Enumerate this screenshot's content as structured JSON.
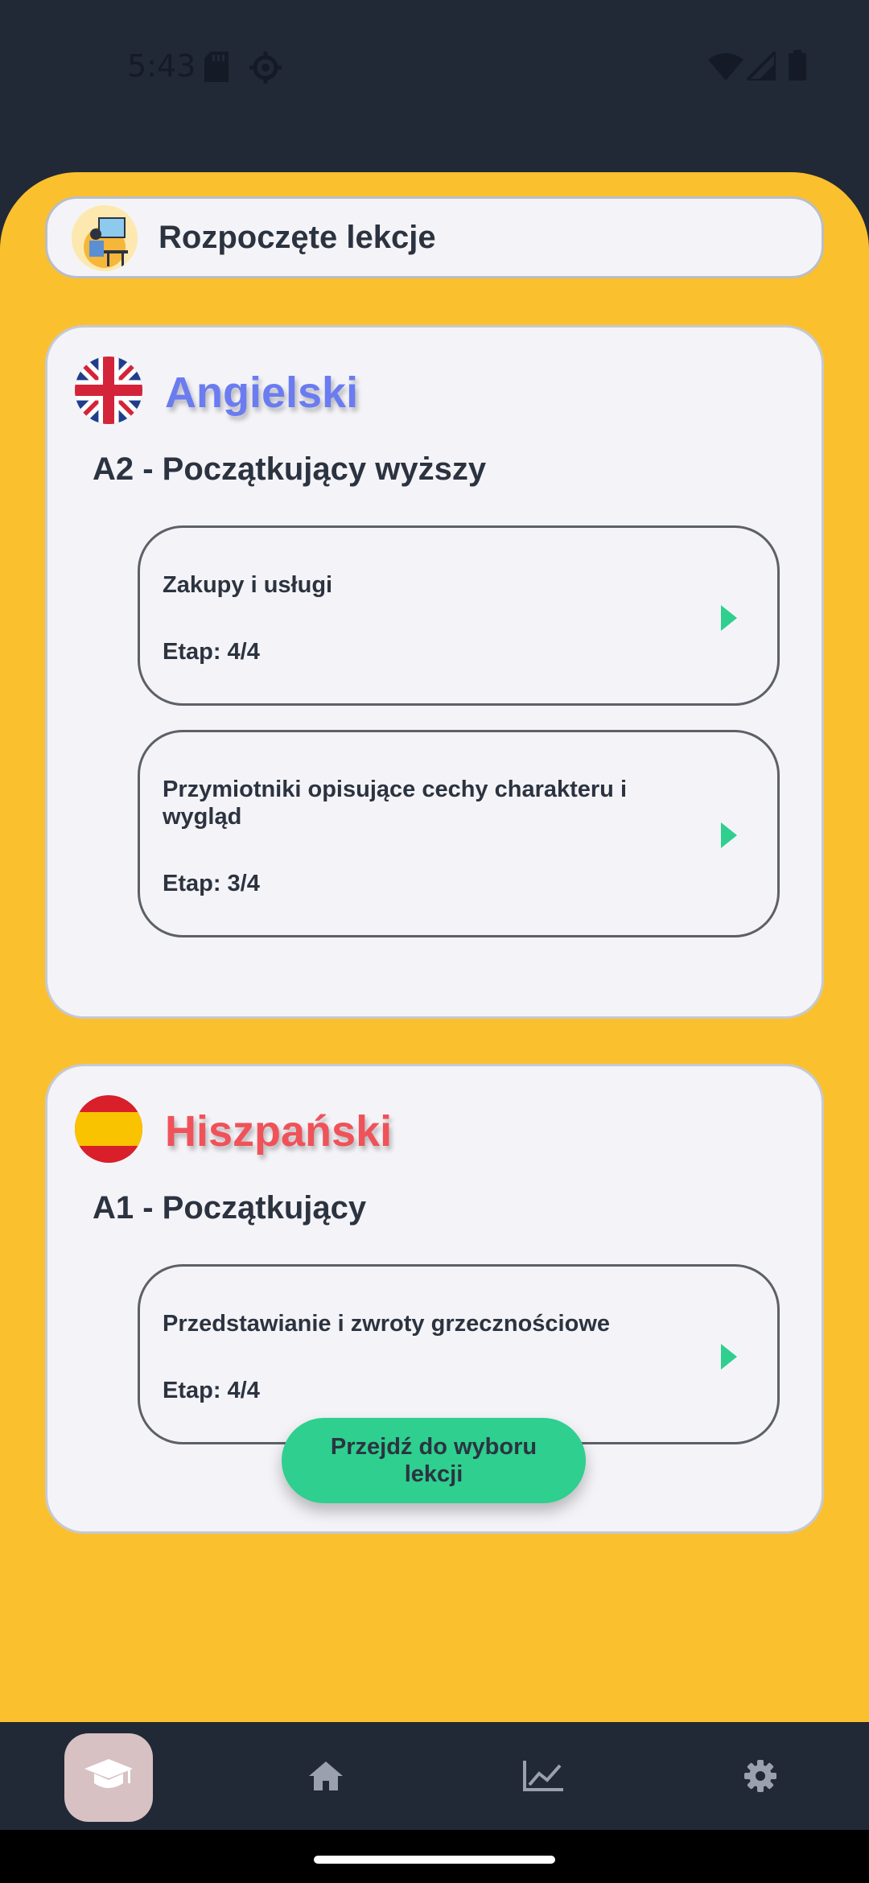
{
  "status_bar": {
    "time": "5:43"
  },
  "header": {
    "title": "Rozpoczęte lekcje"
  },
  "languages": [
    {
      "name": "Angielski",
      "color": "#6b7cf0",
      "level": "A2 - Początkujący wyższy",
      "lessons": [
        {
          "title": "Zakupy i usługi",
          "stage": "Etap: 4/4"
        },
        {
          "title": "Przymiotniki opisujące cechy charakteru i wygląd",
          "stage": "Etap: 3/4"
        }
      ]
    },
    {
      "name": "Hiszpański",
      "color": "#f0525a",
      "level": "A1 - Początkujący",
      "lessons": [
        {
          "title": "Przedstawianie i zwroty grzecznościowe",
          "stage": "Etap: 4/4"
        }
      ]
    }
  ],
  "cta": {
    "label": "Przejdź do wyboru lekcji"
  },
  "bottom_nav": {
    "items": [
      {
        "icon": "graduation-cap-icon",
        "active": true
      },
      {
        "icon": "home-icon",
        "active": false
      },
      {
        "icon": "chart-line-icon",
        "active": false
      },
      {
        "icon": "gear-icon",
        "active": false
      }
    ]
  },
  "colors": {
    "background": "#212937",
    "panel": "#fbc02d",
    "card": "#f4f4f8",
    "accent_green": "#2ecf8f"
  }
}
